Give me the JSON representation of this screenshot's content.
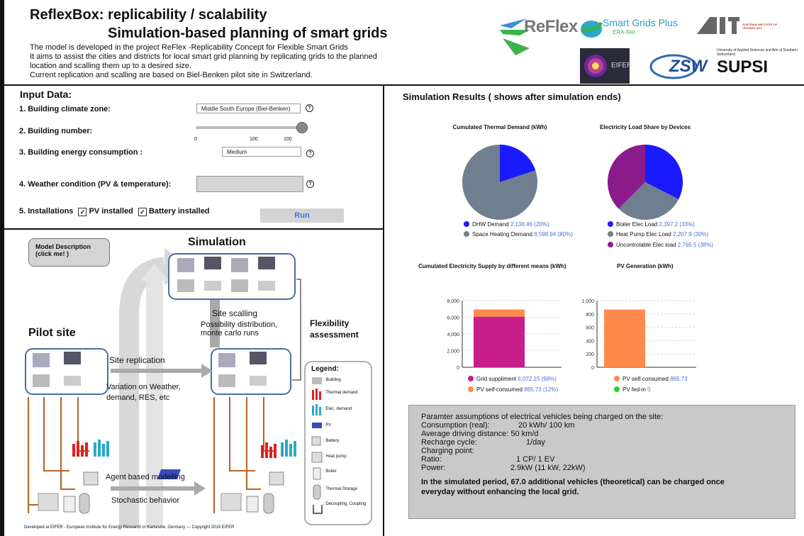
{
  "header": {
    "title_line1": "ReflexBox: replicability / scalability",
    "title_line2": "Simulation-based planning of smart grids",
    "description": [
      "The model is developed in the project ReFlex -Replicability Concept for Flexible Smart Grids",
      "It aims to assist the cities and districts for local smart grid planning by replicating grids to the planned",
      "location and scalling them up to a desired size.",
      "Current replication and scalling are based on Biel-Benken pilot site in Switzerland."
    ]
  },
  "logos": {
    "reflex": "ReFlex",
    "smartgrids_line1": "Smart Grids Plus",
    "smartgrids_line2": "ERA-Net",
    "ait": "AIT",
    "ait_sub": "AUSTRIAN INSTITUTE OF TECHNOLOGY",
    "eifer": "EIFER",
    "zsw": "ZSW",
    "supsi_sub": "University of Applied Sciences and Arts of Southern Switzerland",
    "supsi": "SUPSI"
  },
  "input": {
    "title": "Input Data:",
    "q1_label": "1. Building climate zone:",
    "q1_value": "Middle South Europe (Biel-Benken)",
    "q2_label": "2. Building number:",
    "slider_ticks": [
      "0",
      "100",
      "100"
    ],
    "slider_value": 1.0,
    "q3_label": "3. Building energy consumption :",
    "q3_value": "Medium",
    "q4_label": "4. Weather condition (PV & temperature):",
    "q5_label": "5. Installations",
    "pv_label": "PV installed",
    "battery_label": "Battery installed",
    "run_label": "Run",
    "help_glyph": "?"
  },
  "diagram": {
    "model_btn_line1": "Model Description",
    "model_btn_line2": "(click me! )",
    "simulation": "Simulation",
    "pilot_site": "Pilot site",
    "site_scalling": "Site scalling",
    "possibility_1": "Possibility distribution,",
    "possibility_2": "monte carlo runs",
    "flex_1": "Flexibility",
    "flex_2": "assessment",
    "site_replication": "Site replication",
    "variation_1": "Variation on Weather,",
    "variation_2": "demand, RES, etc",
    "agent": "Agent based modelling",
    "stochastic": "Stochastic behavior",
    "legend_title": "Legend:",
    "legend_items": [
      ": Building",
      ": Thermal demand",
      ": Elec. demand",
      ": PV",
      ": Battery",
      ": Heat pump",
      ": Boiler",
      ": Thermal Storage",
      ": Decoupling, Coupling"
    ]
  },
  "footer": "Developed at EIFER - European Institute for Energy Research in Karlsruhe, Germany --- Copyright 2019 EIFER",
  "results": {
    "title": "Simulation Results ( shows after simulation ends)"
  },
  "colors": {
    "blue": "#1a1aff",
    "grey": "#6f7f8f",
    "purple": "#8b1a8b",
    "magenta": "#c81e8c",
    "orange": "#ff8a4c",
    "green": "#2ecc2e",
    "value_blue": "#4a6fd0"
  },
  "chart_data": [
    {
      "type": "pie",
      "title": "Cumulated Thermal Demand (kWh)",
      "labels": [
        "DHW Demand",
        "Space Heating Demand"
      ],
      "values": [
        2138.46,
        8598.94
      ],
      "value_labels": [
        "2,138.46 (20%)",
        "8,598.94 (80%)"
      ],
      "colors": [
        "#1a1aff",
        "#6f7f8f"
      ]
    },
    {
      "type": "pie",
      "title": "Electricity Load Share by Devices",
      "labels": [
        "Boiler Elec Load",
        "Heat Pump Elec Load",
        "Uncontrolable Elec load"
      ],
      "values": [
        2397.2,
        2207.9,
        2765.5
      ],
      "value_labels": [
        "2,397.2 (33%)",
        "2,207.9 (30%)",
        "2,765.5 (38%)"
      ],
      "colors": [
        "#1a1aff",
        "#6f7f8f",
        "#8b1a8b"
      ]
    },
    {
      "type": "bar",
      "title": "Cumulated Electricity Supply by different means (kWh)",
      "stacked": true,
      "ylim": [
        0,
        8000
      ],
      "yticks": [
        "0",
        "2,000",
        "4,000",
        "6,000",
        "8,000"
      ],
      "ytick_values": [
        0,
        2000,
        4000,
        6000,
        8000
      ],
      "series": [
        {
          "name": "Grid suppliment",
          "values": [
            6072.15
          ],
          "value_label": "6,072.15 (88%)",
          "color": "#c81e8c"
        },
        {
          "name": "PV self-consumed",
          "values": [
            865.73
          ],
          "value_label": "865.73 (12%)",
          "color": "#ff8a4c"
        }
      ]
    },
    {
      "type": "bar",
      "title": "PV Generation (kWh)",
      "stacked": true,
      "ylim": [
        0,
        1000
      ],
      "yticks": [
        "0",
        "200",
        "400",
        "600",
        "800",
        "1,000"
      ],
      "ytick_values": [
        0,
        200,
        400,
        600,
        800,
        1000
      ],
      "series": [
        {
          "name": "PV self-consumed",
          "values": [
            865.73
          ],
          "value_label": "865.73",
          "color": "#ff8a4c"
        },
        {
          "name": "PV fed-in",
          "values": [
            0
          ],
          "value_label": "0",
          "color": "#2ecc2e"
        }
      ]
    }
  ],
  "ev": {
    "line1": "Paramter assumptions of electrical vehicles being charged on the site:",
    "consumption_label": "Consumption (real):",
    "consumption_value": "20 kWh/ 100 km",
    "distance": "Average driving distance: 50 km/d",
    "recharge_label": "Recharge cycle:",
    "recharge_value": "1/day",
    "charging_point": "Charging point:",
    "ratio_label": "Ratio:",
    "ratio_value": "1 CP/ 1 EV",
    "power_label": "Power:",
    "power_value": "2.9kW (11 kW, 22kW)",
    "result_line1": "In the simulated period, 67.0 additional vehicles (theoretical) can be charged once",
    "result_line2": "everyday without enhancing the local grid."
  }
}
